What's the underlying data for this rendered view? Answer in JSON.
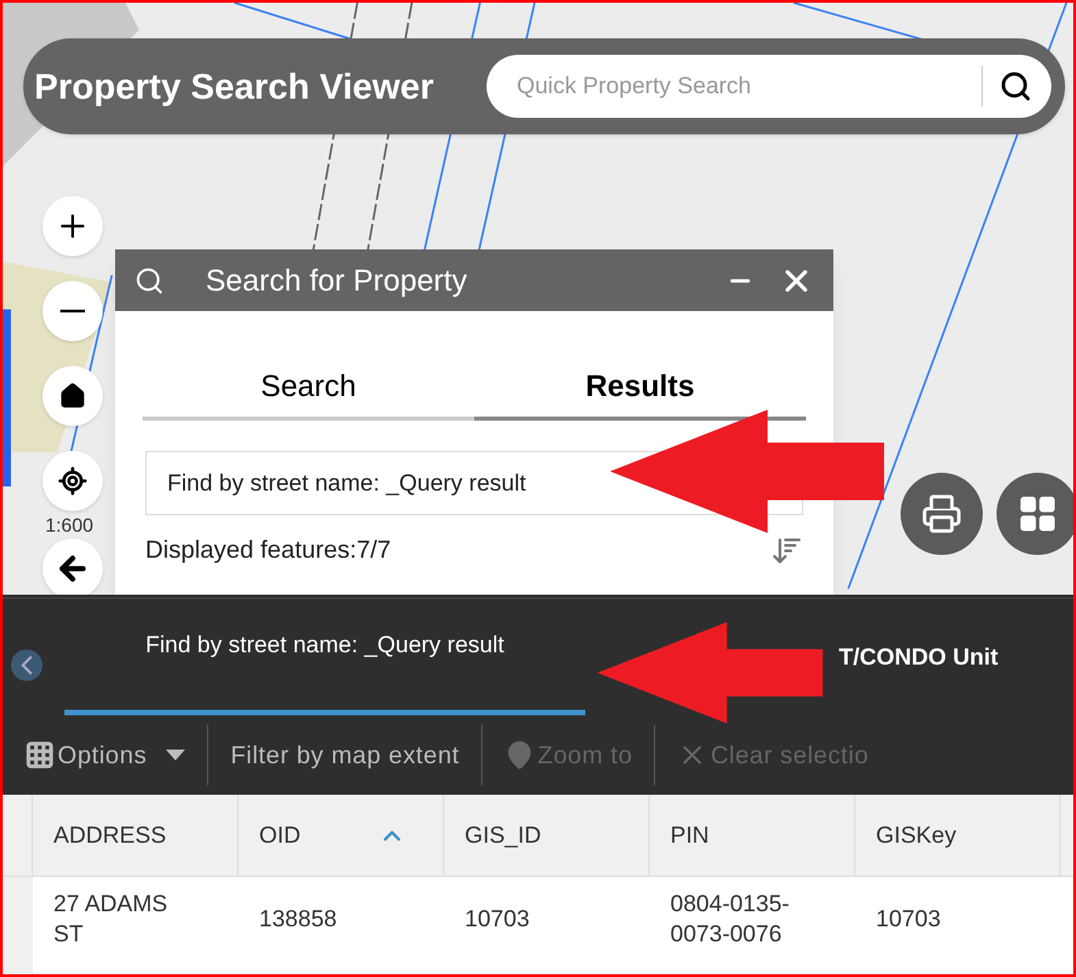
{
  "header": {
    "title": "Property Search Viewer",
    "search": {
      "placeholder": "Quick Property Search"
    }
  },
  "map_controls": {
    "scale": "1:600"
  },
  "panel": {
    "title": "Search for Property",
    "tabs": [
      {
        "label": "Search",
        "selected": false
      },
      {
        "label": "Results",
        "selected": true
      }
    ],
    "result_title": "Find by street name: _Query result",
    "features": "Displayed features:7/7"
  },
  "attribute_table": {
    "tabs": [
      {
        "label": "Find by street name: _Query result",
        "selected": true
      },
      {
        "label": "T/CONDO Unit",
        "selected": false
      }
    ],
    "toolbar": [
      {
        "label": "Options",
        "kind": "menu",
        "disabled": false
      },
      {
        "label": "Filter by map extent",
        "kind": "plain",
        "disabled": false
      },
      {
        "label": "Zoom to",
        "kind": "zoom",
        "disabled": true
      },
      {
        "label": "Clear selectio",
        "kind": "clear",
        "disabled": true
      }
    ],
    "columns": [
      {
        "label": "ADDRESS",
        "sorted": false
      },
      {
        "label": "OID",
        "sorted": true
      },
      {
        "label": "GIS_ID",
        "sorted": false
      },
      {
        "label": "PIN",
        "sorted": false
      },
      {
        "label": "GISKey",
        "sorted": false
      }
    ],
    "rows": [
      [
        "27 ADAMS ST",
        "138858",
        "10703",
        "0804-0135-0073-0076",
        "10703"
      ]
    ]
  }
}
